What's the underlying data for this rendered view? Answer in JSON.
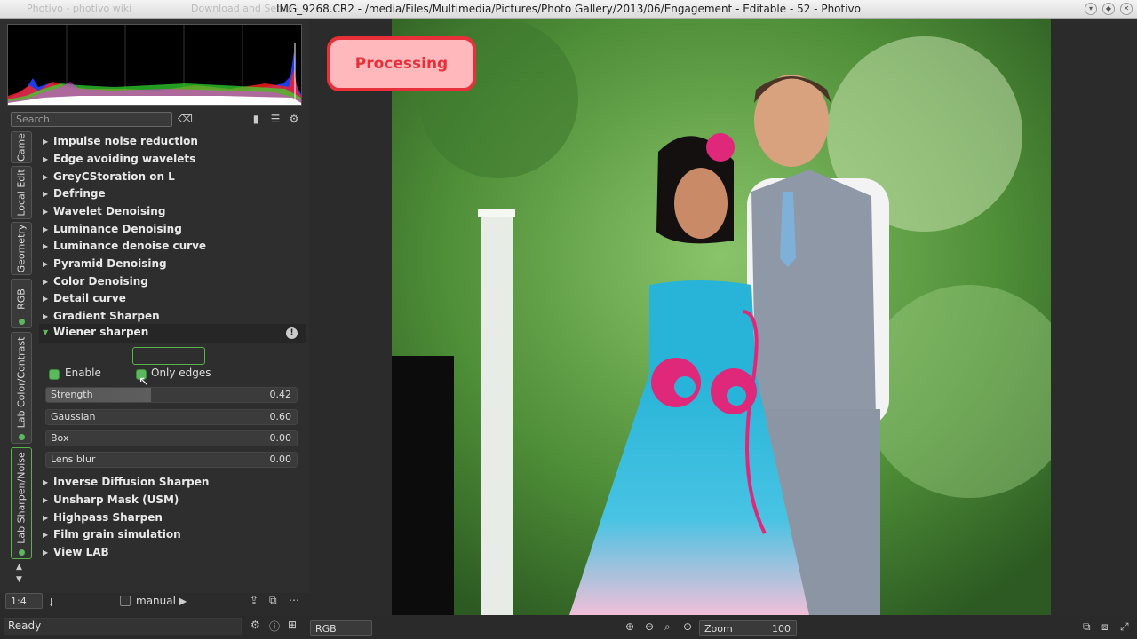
{
  "titlebar": {
    "title": "IMG_9268.CR2 - /media/Files/Multimedia/Pictures/Photo Gallery/2013/06/Engagement - Editable - 52 - Photivo",
    "ghost_tab1": "Photivo - photivo wiki",
    "ghost_tab2": "Download and Setup -"
  },
  "search": {
    "placeholder": "Search"
  },
  "vtabs": [
    "Came",
    "Local Edit",
    "Geometry",
    "RGB",
    "Lab Color/Contrast",
    "Lab Sharpen/Noise"
  ],
  "modules_before": [
    "Impulse noise reduction",
    "Edge avoiding wavelets",
    "GreyCStoration on L",
    "Defringe",
    "Wavelet Denoising",
    "Luminance Denoising",
    "Luminance denoise curve",
    "Pyramid Denoising",
    "Color Denoising",
    "Detail curve",
    "Gradient Sharpen"
  ],
  "wiener": {
    "title": "Wiener sharpen",
    "enable_label": "Enable",
    "only_edges_label": "Only edges",
    "sliders": [
      {
        "label": "Strength",
        "value": "0.42",
        "fraction": 0.42
      },
      {
        "label": "Gaussian",
        "value": "0.60",
        "fraction": 0.0
      },
      {
        "label": "Box",
        "value": "0.00",
        "fraction": 0.0
      },
      {
        "label": "Lens blur",
        "value": "0.00",
        "fraction": 0.0
      }
    ]
  },
  "modules_after": [
    "Inverse Diffusion Sharpen",
    "Unsharp Mask (USM)",
    "Highpass Sharpen",
    "Film grain simulation",
    "View LAB"
  ],
  "bottombar": {
    "zoom_ratio": "1:4",
    "manual_label": "manual"
  },
  "status": {
    "text": "Ready",
    "color_mode": "RGB",
    "zoom_label": "Zoom",
    "zoom_value": "100"
  },
  "overlay": {
    "processing": "Processing"
  },
  "colors": {
    "accent_green": "#5cb85c",
    "processing_red": "#e8303a",
    "processing_bg": "#ffb9bc"
  }
}
